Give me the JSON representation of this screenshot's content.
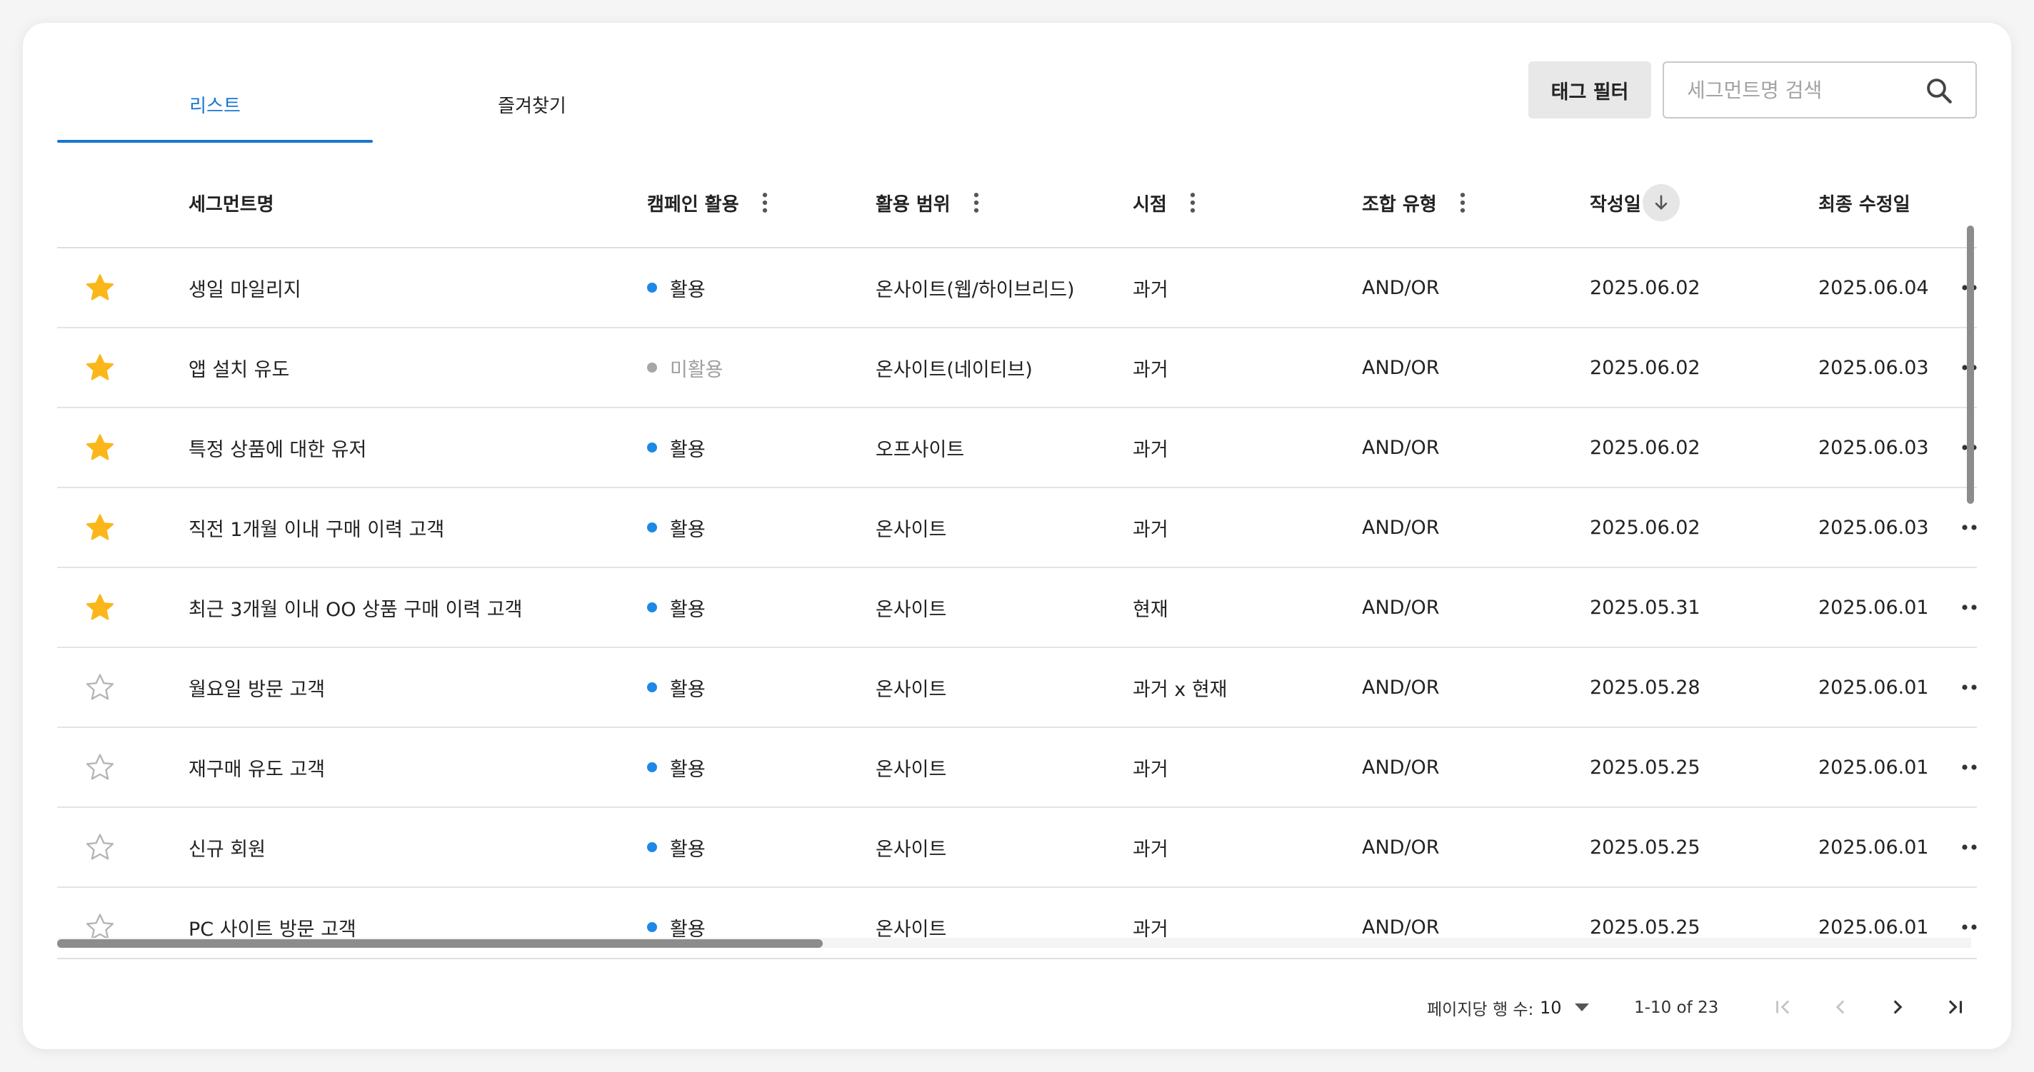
{
  "tabs": {
    "list_label": "리스트",
    "favorites_label": "즐겨찾기"
  },
  "toolbar": {
    "tag_filter_label": "태그 필터",
    "search_placeholder": "세그먼트명 검색",
    "search_value": ""
  },
  "table": {
    "headers": {
      "name": "세그먼트명",
      "campaign": "캠페인 활용",
      "scope": "활용 범위",
      "time": "시점",
      "combo": "조합 유형",
      "created": "작성일",
      "modified": "최종 수정일"
    },
    "rows": [
      {
        "starred": true,
        "name": "생일 마일리지",
        "campaign": "활용",
        "campaign_active": true,
        "scope": "온사이트(웹/하이브리드)",
        "time": "과거",
        "combo": "AND/OR",
        "created": "2025.06.02",
        "modified": "2025.06.04"
      },
      {
        "starred": true,
        "name": "앱 설치 유도",
        "campaign": "미활용",
        "campaign_active": false,
        "scope": "온사이트(네이티브)",
        "time": "과거",
        "combo": "AND/OR",
        "created": "2025.06.02",
        "modified": "2025.06.03"
      },
      {
        "starred": true,
        "name": "특정 상품에 대한 유저",
        "campaign": "활용",
        "campaign_active": true,
        "scope": "오프사이트",
        "time": "과거",
        "combo": "AND/OR",
        "created": "2025.06.02",
        "modified": "2025.06.03"
      },
      {
        "starred": true,
        "name": "직전 1개월 이내 구매 이력 고객",
        "campaign": "활용",
        "campaign_active": true,
        "scope": "온사이트",
        "time": "과거",
        "combo": "AND/OR",
        "created": "2025.06.02",
        "modified": "2025.06.03"
      },
      {
        "starred": true,
        "name": "최근 3개월 이내 OO 상품 구매 이력 고객",
        "campaign": "활용",
        "campaign_active": true,
        "scope": "온사이트",
        "time": "현재",
        "combo": "AND/OR",
        "created": "2025.05.31",
        "modified": "2025.06.01"
      },
      {
        "starred": false,
        "name": "월요일 방문 고객",
        "campaign": "활용",
        "campaign_active": true,
        "scope": "온사이트",
        "time": "과거 x 현재",
        "combo": "AND/OR",
        "created": "2025.05.28",
        "modified": "2025.06.01"
      },
      {
        "starred": false,
        "name": "재구매 유도 고객",
        "campaign": "활용",
        "campaign_active": true,
        "scope": "온사이트",
        "time": "과거",
        "combo": "AND/OR",
        "created": "2025.05.25",
        "modified": "2025.06.01"
      },
      {
        "starred": false,
        "name": "신규 회원",
        "campaign": "활용",
        "campaign_active": true,
        "scope": "온사이트",
        "time": "과거",
        "combo": "AND/OR",
        "created": "2025.05.25",
        "modified": "2025.06.01"
      },
      {
        "starred": false,
        "name": "PC 사이트 방문 고객",
        "campaign": "활용",
        "campaign_active": true,
        "scope": "온사이트",
        "time": "과거",
        "combo": "AND/OR",
        "created": "2025.05.25",
        "modified": "2025.06.01"
      }
    ]
  },
  "pagination": {
    "rows_per_page_label": "페이지당 행 수:",
    "rows_per_page_value": "10",
    "range_text": "1-10 of 23"
  },
  "colors": {
    "accent": "#1976d2",
    "star_filled": "#fbb619",
    "star_outline": "#b5b5b5",
    "active_dot": "#1e88e5",
    "inactive_dot": "#a6a6a6"
  },
  "icons": {
    "search": "search-icon",
    "column_menu": "kebab-icon",
    "sort": "arrow-down-icon",
    "row_menu": "more-horizontal-icon",
    "favorite": "star-icon"
  }
}
